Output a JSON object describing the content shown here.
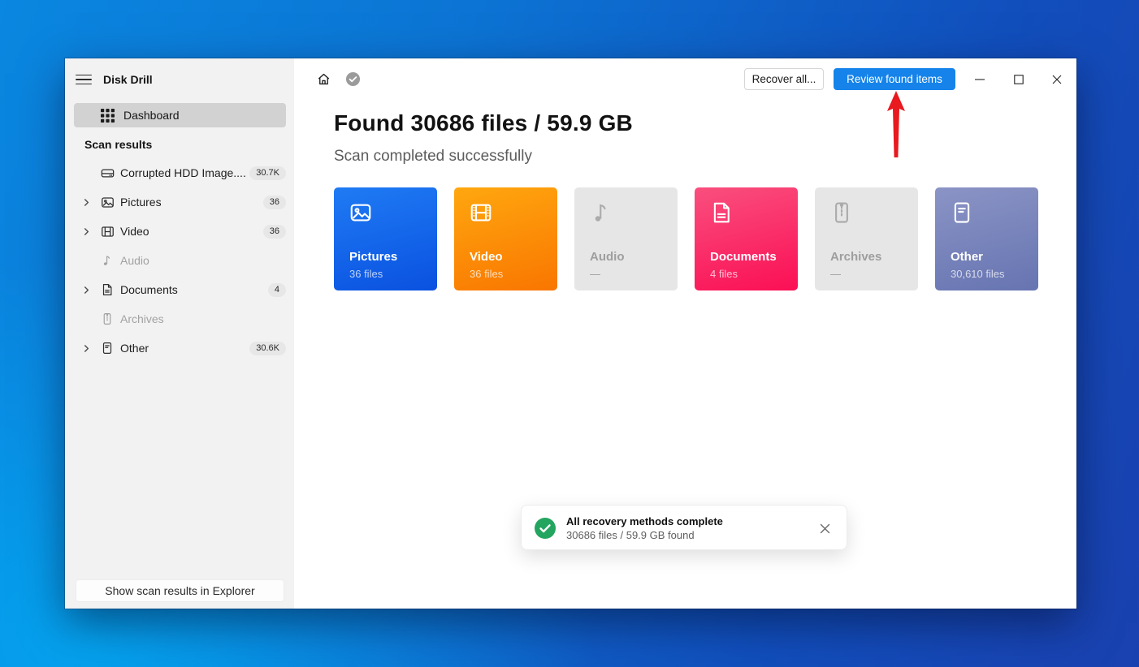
{
  "window": {
    "title": "Disk Drill"
  },
  "sidebar": {
    "title": "Disk Drill",
    "dashboard_label": "Dashboard",
    "section_header": "Scan results",
    "items": [
      {
        "label": "Corrupted HDD Image....",
        "badge": "30.7K",
        "icon": "drive-icon",
        "chevron": false,
        "disabled": false
      },
      {
        "label": "Pictures",
        "badge": "36",
        "icon": "pictures-icon",
        "chevron": true,
        "disabled": false
      },
      {
        "label": "Video",
        "badge": "36",
        "icon": "video-icon",
        "chevron": true,
        "disabled": false
      },
      {
        "label": "Audio",
        "badge": "",
        "icon": "audio-icon",
        "chevron": false,
        "disabled": true
      },
      {
        "label": "Documents",
        "badge": "4",
        "icon": "documents-icon",
        "chevron": true,
        "disabled": false
      },
      {
        "label": "Archives",
        "badge": "",
        "icon": "archives-icon",
        "chevron": false,
        "disabled": true
      },
      {
        "label": "Other",
        "badge": "30.6K",
        "icon": "other-icon",
        "chevron": true,
        "disabled": false
      }
    ],
    "footer_button": "Show scan results in Explorer"
  },
  "toolbar": {
    "recover_all_label": "Recover all...",
    "review_label": "Review found items"
  },
  "main": {
    "heading": "Found 30686 files / 59.9 GB",
    "subheading": "Scan completed successfully",
    "cards": [
      {
        "label": "Pictures",
        "count": "36 files",
        "icon": "pictures-icon",
        "state": "active"
      },
      {
        "label": "Video",
        "count": "36 files",
        "icon": "video-icon",
        "state": "active"
      },
      {
        "label": "Audio",
        "count": "—",
        "icon": "audio-icon",
        "state": "disabled"
      },
      {
        "label": "Documents",
        "count": "4 files",
        "icon": "documents-icon",
        "state": "active"
      },
      {
        "label": "Archives",
        "count": "—",
        "icon": "archives-icon",
        "state": "disabled"
      },
      {
        "label": "Other",
        "count": "30,610 files",
        "icon": "other-icon",
        "state": "active"
      }
    ]
  },
  "toast": {
    "title": "All recovery methods complete",
    "subtitle": "30686 files / 59.9 GB found"
  },
  "colors": {
    "accent_blue": "#1583ea",
    "card_pictures_top": "#1f7bf4",
    "card_pictures_bottom": "#0a51e0",
    "card_video_top": "#ffa70f",
    "card_video_bottom": "#f97600",
    "card_documents_top": "#f94f7e",
    "card_documents_bottom": "#fb0f55",
    "card_other_top": "#8b94c5",
    "card_other_bottom": "#6674b1",
    "card_disabled": "#e6e6e6",
    "toast_green": "#23a55f",
    "arrow_red": "#e8191f",
    "sidebar_bg": "#f2f2f2",
    "sidebar_selected": "#d2d2d2",
    "desktop_blue_bright": "#00aef5",
    "desktop_blue_deep": "#1a41b0"
  }
}
